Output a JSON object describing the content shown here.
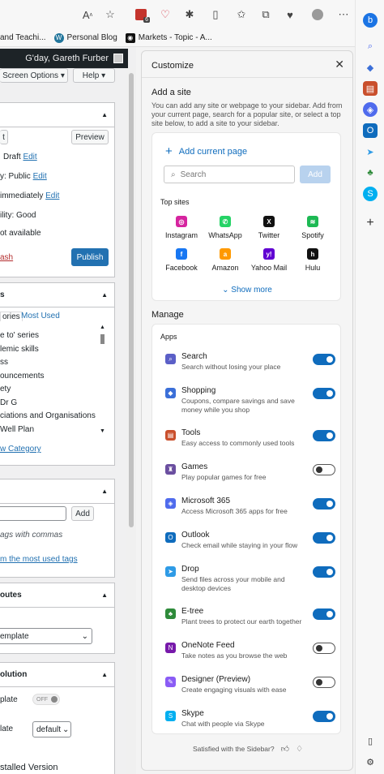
{
  "bookmarks": [
    {
      "label": "and Teachi...",
      "color": "#2d6db5"
    },
    {
      "label": "Personal Blog",
      "color": "#21759b"
    },
    {
      "label": "Markets - Topic - A...",
      "color": "#111111"
    }
  ],
  "toolbar": {
    "badge": "6"
  },
  "wordpress": {
    "greeting": "G'day, Gareth Furber",
    "screen_options": "Screen Options",
    "help": "Help",
    "preview": "Preview",
    "status_prefix": "Draft",
    "edit": "Edit",
    "visibility": "y: Public",
    "publish_when": "immediately",
    "readability": "ility: Good",
    "not_available": "ot available",
    "trash": "ash",
    "publish": "Publish",
    "cat_tab_all": "ories",
    "cat_tab_most": "Most Used",
    "categories": [
      "e to' series",
      "lemic skills",
      "ss",
      "ouncements",
      "ety",
      "Dr G",
      "ciations and Organisations",
      "Well Plan"
    ],
    "new_category": "w Category",
    "tags_add": "Add",
    "tags_hint": "ags with commas",
    "tags_link": "m the most used tags",
    "attributes": "outes",
    "template": "emplate",
    "solution": "olution",
    "plate": "plate",
    "off": "OFF",
    "late": "late",
    "default": "default",
    "installed": "stalled Version"
  },
  "panel": {
    "title": "Customize",
    "add_site_title": "Add a site",
    "add_site_desc": "You can add any site or webpage to your sidebar. Add from your current page, search for a popular site, or select a top site below, to add a site to your sidebar.",
    "add_current_page": "Add current page",
    "search_placeholder": "Search",
    "add_button": "Add",
    "top_sites_label": "Top sites",
    "top_sites": [
      {
        "name": "Instagram",
        "glyph": "◎",
        "color": "#d6249f"
      },
      {
        "name": "WhatsApp",
        "glyph": "✆",
        "color": "#25d366"
      },
      {
        "name": "Twitter",
        "glyph": "X",
        "color": "#111111"
      },
      {
        "name": "Spotify",
        "glyph": "≋",
        "color": "#1db954"
      },
      {
        "name": "Facebook",
        "glyph": "f",
        "color": "#1877f2"
      },
      {
        "name": "Amazon",
        "glyph": "a",
        "color": "#ff9900"
      },
      {
        "name": "Yahoo Mail",
        "glyph": "y!",
        "color": "#6001d2"
      },
      {
        "name": "Hulu",
        "glyph": "h",
        "color": "#111111"
      }
    ],
    "show_more": "Show more",
    "manage_title": "Manage",
    "apps_label": "Apps",
    "apps": [
      {
        "name": "Search",
        "desc": "Search without losing your place",
        "on": true,
        "icon": "search-icon",
        "color": "#5b5fc7",
        "glyph": "⌕"
      },
      {
        "name": "Shopping",
        "desc": "Coupons, compare savings and save money while you shop",
        "on": true,
        "icon": "shopping-tag-icon",
        "color": "#3b6fd8",
        "glyph": "◆"
      },
      {
        "name": "Tools",
        "desc": "Easy access to commonly used tools",
        "on": true,
        "icon": "toolbox-icon",
        "color": "#c94f2c",
        "glyph": "▤"
      },
      {
        "name": "Games",
        "desc": "Play popular games for free",
        "on": false,
        "icon": "chess-piece-icon",
        "color": "#6b4fa0",
        "glyph": "♜"
      },
      {
        "name": "Microsoft 365",
        "desc": "Access Microsoft 365 apps for free",
        "on": true,
        "icon": "microsoft365-icon",
        "color": "#4f6bed",
        "glyph": "◈"
      },
      {
        "name": "Outlook",
        "desc": "Check email while staying in your flow",
        "on": true,
        "icon": "outlook-icon",
        "color": "#0f6cbd",
        "glyph": "O"
      },
      {
        "name": "Drop",
        "desc": "Send files across your mobile and desktop devices",
        "on": true,
        "icon": "drop-icon",
        "color": "#2e9be6",
        "glyph": "➤"
      },
      {
        "name": "E-tree",
        "desc": "Plant trees to protect our earth together",
        "on": true,
        "icon": "tree-icon",
        "color": "#2e8b3a",
        "glyph": "♣"
      },
      {
        "name": "OneNote Feed",
        "desc": "Take notes as you browse the web",
        "on": false,
        "icon": "onenote-icon",
        "color": "#7719aa",
        "glyph": "N"
      },
      {
        "name": "Designer (Preview)",
        "desc": "Create engaging visuals with ease",
        "on": false,
        "icon": "designer-icon",
        "color": "#8a5cf5",
        "glyph": "✎"
      },
      {
        "name": "Skype",
        "desc": "Chat with people via Skype",
        "on": true,
        "icon": "skype-icon",
        "color": "#00aff0",
        "glyph": "S"
      }
    ],
    "feedback_text": "Satisfied with the Sidebar?"
  }
}
